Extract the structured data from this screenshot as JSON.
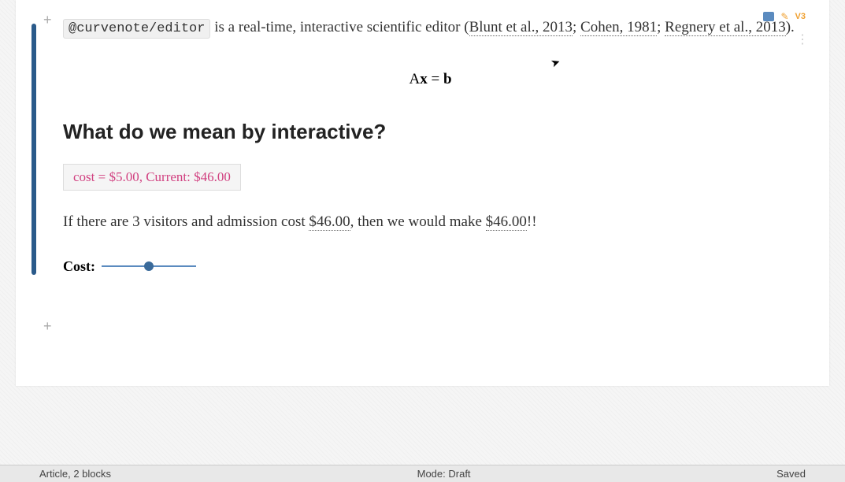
{
  "toolbar": {
    "version": "V3"
  },
  "intro": {
    "package_name": "@curvenote/editor",
    "text_after": " is a real-time, interactive scientific editor (",
    "citation1": "Blunt et al., 2013",
    "sep1": "; ",
    "citation2": "Cohen, 1981",
    "sep2": "; ",
    "citation3": "Regnery et al., 2013",
    "close": ")."
  },
  "equation": {
    "A": "A",
    "x": "x",
    "eq": " = ",
    "b": "b"
  },
  "heading": "What do we mean by interactive?",
  "variable_box": "cost = $5.00, Current: $46.00",
  "body": {
    "part1": "If there are 3 visitors and admission cost ",
    "value1": "$46.00",
    "part2": ", then we would make ",
    "value2": "$46.00",
    "part3": "!!"
  },
  "slider": {
    "label": "Cost:"
  },
  "status": {
    "left": "Article, 2 blocks",
    "center": "Mode: Draft",
    "right": "Saved"
  }
}
